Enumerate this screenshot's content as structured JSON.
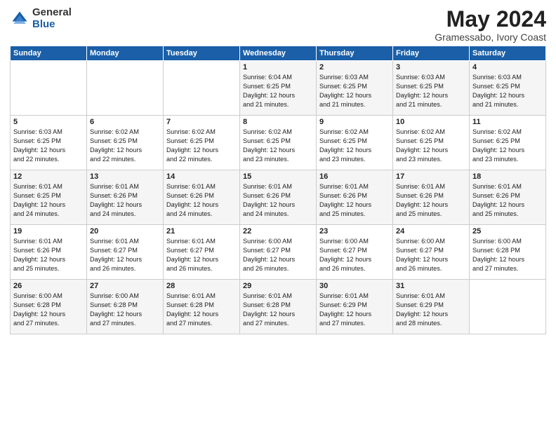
{
  "logo": {
    "general": "General",
    "blue": "Blue"
  },
  "title": {
    "month_year": "May 2024",
    "location": "Gramessabo, Ivory Coast"
  },
  "days_of_week": [
    "Sunday",
    "Monday",
    "Tuesday",
    "Wednesday",
    "Thursday",
    "Friday",
    "Saturday"
  ],
  "weeks": [
    [
      {
        "day": "",
        "info": ""
      },
      {
        "day": "",
        "info": ""
      },
      {
        "day": "",
        "info": ""
      },
      {
        "day": "1",
        "info": "Sunrise: 6:04 AM\nSunset: 6:25 PM\nDaylight: 12 hours\nand 21 minutes."
      },
      {
        "day": "2",
        "info": "Sunrise: 6:03 AM\nSunset: 6:25 PM\nDaylight: 12 hours\nand 21 minutes."
      },
      {
        "day": "3",
        "info": "Sunrise: 6:03 AM\nSunset: 6:25 PM\nDaylight: 12 hours\nand 21 minutes."
      },
      {
        "day": "4",
        "info": "Sunrise: 6:03 AM\nSunset: 6:25 PM\nDaylight: 12 hours\nand 21 minutes."
      }
    ],
    [
      {
        "day": "5",
        "info": "Sunrise: 6:03 AM\nSunset: 6:25 PM\nDaylight: 12 hours\nand 22 minutes."
      },
      {
        "day": "6",
        "info": "Sunrise: 6:02 AM\nSunset: 6:25 PM\nDaylight: 12 hours\nand 22 minutes."
      },
      {
        "day": "7",
        "info": "Sunrise: 6:02 AM\nSunset: 6:25 PM\nDaylight: 12 hours\nand 22 minutes."
      },
      {
        "day": "8",
        "info": "Sunrise: 6:02 AM\nSunset: 6:25 PM\nDaylight: 12 hours\nand 23 minutes."
      },
      {
        "day": "9",
        "info": "Sunrise: 6:02 AM\nSunset: 6:25 PM\nDaylight: 12 hours\nand 23 minutes."
      },
      {
        "day": "10",
        "info": "Sunrise: 6:02 AM\nSunset: 6:25 PM\nDaylight: 12 hours\nand 23 minutes."
      },
      {
        "day": "11",
        "info": "Sunrise: 6:02 AM\nSunset: 6:25 PM\nDaylight: 12 hours\nand 23 minutes."
      }
    ],
    [
      {
        "day": "12",
        "info": "Sunrise: 6:01 AM\nSunset: 6:25 PM\nDaylight: 12 hours\nand 24 minutes."
      },
      {
        "day": "13",
        "info": "Sunrise: 6:01 AM\nSunset: 6:26 PM\nDaylight: 12 hours\nand 24 minutes."
      },
      {
        "day": "14",
        "info": "Sunrise: 6:01 AM\nSunset: 6:26 PM\nDaylight: 12 hours\nand 24 minutes."
      },
      {
        "day": "15",
        "info": "Sunrise: 6:01 AM\nSunset: 6:26 PM\nDaylight: 12 hours\nand 24 minutes."
      },
      {
        "day": "16",
        "info": "Sunrise: 6:01 AM\nSunset: 6:26 PM\nDaylight: 12 hours\nand 25 minutes."
      },
      {
        "day": "17",
        "info": "Sunrise: 6:01 AM\nSunset: 6:26 PM\nDaylight: 12 hours\nand 25 minutes."
      },
      {
        "day": "18",
        "info": "Sunrise: 6:01 AM\nSunset: 6:26 PM\nDaylight: 12 hours\nand 25 minutes."
      }
    ],
    [
      {
        "day": "19",
        "info": "Sunrise: 6:01 AM\nSunset: 6:26 PM\nDaylight: 12 hours\nand 25 minutes."
      },
      {
        "day": "20",
        "info": "Sunrise: 6:01 AM\nSunset: 6:27 PM\nDaylight: 12 hours\nand 26 minutes."
      },
      {
        "day": "21",
        "info": "Sunrise: 6:01 AM\nSunset: 6:27 PM\nDaylight: 12 hours\nand 26 minutes."
      },
      {
        "day": "22",
        "info": "Sunrise: 6:00 AM\nSunset: 6:27 PM\nDaylight: 12 hours\nand 26 minutes."
      },
      {
        "day": "23",
        "info": "Sunrise: 6:00 AM\nSunset: 6:27 PM\nDaylight: 12 hours\nand 26 minutes."
      },
      {
        "day": "24",
        "info": "Sunrise: 6:00 AM\nSunset: 6:27 PM\nDaylight: 12 hours\nand 26 minutes."
      },
      {
        "day": "25",
        "info": "Sunrise: 6:00 AM\nSunset: 6:28 PM\nDaylight: 12 hours\nand 27 minutes."
      }
    ],
    [
      {
        "day": "26",
        "info": "Sunrise: 6:00 AM\nSunset: 6:28 PM\nDaylight: 12 hours\nand 27 minutes."
      },
      {
        "day": "27",
        "info": "Sunrise: 6:00 AM\nSunset: 6:28 PM\nDaylight: 12 hours\nand 27 minutes."
      },
      {
        "day": "28",
        "info": "Sunrise: 6:01 AM\nSunset: 6:28 PM\nDaylight: 12 hours\nand 27 minutes."
      },
      {
        "day": "29",
        "info": "Sunrise: 6:01 AM\nSunset: 6:28 PM\nDaylight: 12 hours\nand 27 minutes."
      },
      {
        "day": "30",
        "info": "Sunrise: 6:01 AM\nSunset: 6:29 PM\nDaylight: 12 hours\nand 27 minutes."
      },
      {
        "day": "31",
        "info": "Sunrise: 6:01 AM\nSunset: 6:29 PM\nDaylight: 12 hours\nand 28 minutes."
      },
      {
        "day": "",
        "info": ""
      }
    ]
  ]
}
